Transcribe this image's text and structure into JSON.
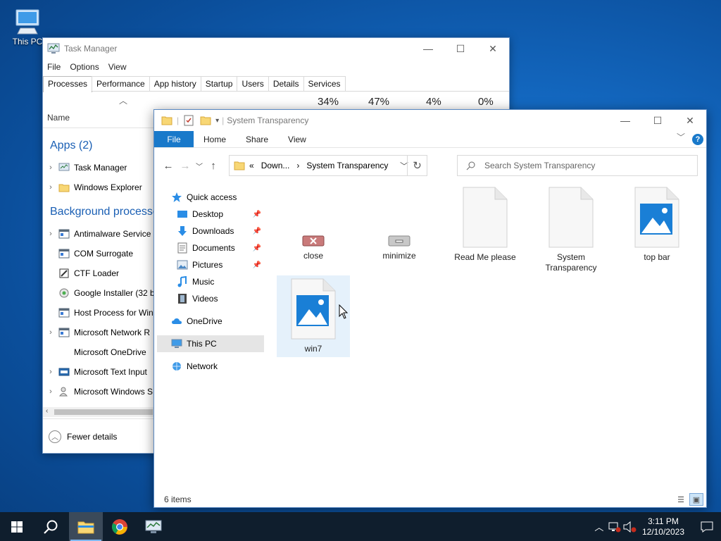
{
  "desktop": {
    "icon_label": "This PC"
  },
  "task_manager": {
    "title": "Task Manager",
    "menu": [
      "File",
      "Options",
      "View"
    ],
    "tabs": [
      "Processes",
      "Performance",
      "App history",
      "Startup",
      "Users",
      "Details",
      "Services"
    ],
    "columns": {
      "name": "Name",
      "cpu": "34%",
      "memory": "47%",
      "disk": "4%",
      "network": "0%"
    },
    "apps_header": "Apps (2)",
    "apps": [
      {
        "name": "Task Manager",
        "icon": "task-manager-icon"
      },
      {
        "name": "Windows Explorer",
        "icon": "folder-icon"
      }
    ],
    "background_header": "Background processes",
    "background": [
      {
        "name": "Antimalware Service",
        "expandable": true
      },
      {
        "name": "COM Surrogate",
        "expandable": false
      },
      {
        "name": "CTF Loader",
        "expandable": false
      },
      {
        "name": "Google Installer (32 b",
        "expandable": false
      },
      {
        "name": "Host Process for Win",
        "expandable": false
      },
      {
        "name": "Microsoft Network R",
        "expandable": true
      },
      {
        "name": "Microsoft OneDrive",
        "expandable": false
      },
      {
        "name": "Microsoft Text Input",
        "expandable": true
      },
      {
        "name": "Microsoft Windows S",
        "expandable": true
      }
    ],
    "fewer_details": "Fewer details"
  },
  "explorer": {
    "title": "System Transparency",
    "ribbon": {
      "file": "File",
      "home": "Home",
      "share": "Share",
      "view": "View"
    },
    "address": {
      "prefix": "«",
      "seg1": "Down...",
      "sep": "›",
      "seg2": "System Transparency"
    },
    "search_placeholder": "Search System Transparency",
    "nav": {
      "quick_access": "Quick access",
      "desktop": "Desktop",
      "downloads": "Downloads",
      "documents": "Documents",
      "pictures": "Pictures",
      "music": "Music",
      "videos": "Videos",
      "onedrive": "OneDrive",
      "this_pc": "This PC",
      "network": "Network"
    },
    "files": [
      {
        "name": "close",
        "type": "image-close"
      },
      {
        "name": "minimize",
        "type": "image-minimize"
      },
      {
        "name": "Read Me please",
        "type": "document"
      },
      {
        "name": "System Transparency",
        "type": "document"
      },
      {
        "name": "top bar",
        "type": "image"
      },
      {
        "name": "win7",
        "type": "image",
        "selected": true
      }
    ],
    "status": "6 items"
  },
  "taskbar": {
    "time": "3:11 PM",
    "date": "12/10/2023"
  },
  "colors": {
    "accent": "#1979ca",
    "selected": "#e5f1fb",
    "taskbar": "#0f1e2d"
  }
}
